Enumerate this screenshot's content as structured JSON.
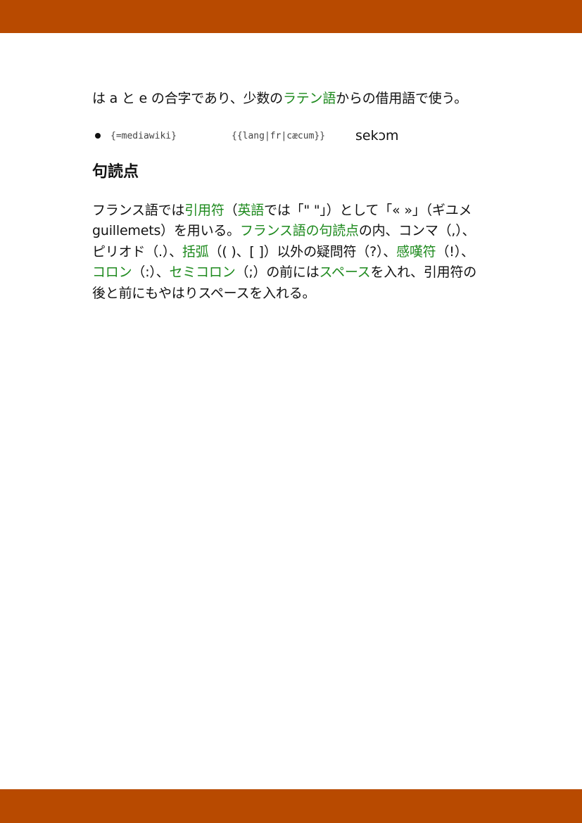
{
  "header": {
    "color": "#b84a00"
  },
  "footer": {
    "color": "#b84a00"
  },
  "link_color": "#1e8a1e",
  "para1": {
    "t1": "は a と e の合字であり、少数の",
    "link1": "ラテン語",
    "t2": "からの借用語で使う。"
  },
  "bullet": {
    "code1": "{=mediawiki}",
    "code2": "{{lang|fr|cæcum}}",
    "ipa": "sekɔm"
  },
  "section": {
    "heading": "句読点"
  },
  "para2": {
    "t1": "フランス語では",
    "link_quote": "引用符",
    "t2": "（",
    "link_english": "英語",
    "t3": "では「\" \"」）として「« »」（ギユメ guillemets）を用いる。",
    "link_punct": "フランス語の句読点",
    "t4": "の内、コンマ（,）、ピリオド（.）、",
    "link_bracket": "括弧",
    "t5": "（( )、[ ]）以外の疑問符（?）、",
    "link_exclaim": "感嘆符",
    "t6": "（!）、",
    "link_colon": "コロン",
    "t7": "（:）、",
    "link_semicolon": "セミコロン",
    "t8": "（;）の前には",
    "link_space": "スペース",
    "t9": "を入れ、引用符の後と前にもやはりスペースを入れる。"
  }
}
